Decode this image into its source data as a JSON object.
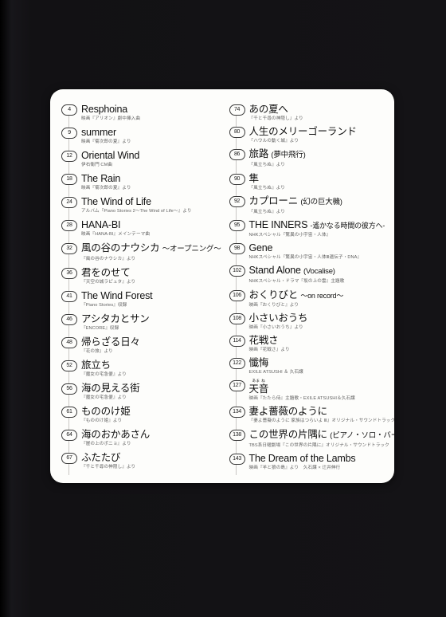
{
  "card": {
    "background": "#fdfdfb",
    "page_background": "#131215"
  },
  "tracklist": {
    "left": [
      {
        "number": "4",
        "title": "Resphoina",
        "note": "映画『アリオン』劇中挿入曲"
      },
      {
        "number": "9",
        "title": "summer",
        "note": "映画『菊次郎の夏』より"
      },
      {
        "number": "12",
        "title": "Oriental Wind",
        "note": "伊右衛門 CM曲"
      },
      {
        "number": "18",
        "title": "The Rain",
        "note": "映画『菊次郎の夏』より"
      },
      {
        "number": "24",
        "title": "The Wind of Life",
        "note": "アルバム『Piano Stories 2～The Wind of Life～』より"
      },
      {
        "number": "28",
        "title": "HANA-BI",
        "note": "映画『HANA-BI』メインテーマ曲"
      },
      {
        "number": "32",
        "title": "風の谷のナウシカ",
        "title_suffix": "～オープニング～",
        "note": "『風の谷のナウシカ』より"
      },
      {
        "number": "36",
        "title": "君をのせて",
        "note": "『天空の城ラピュタ』より"
      },
      {
        "number": "41",
        "title": "The Wind Forest",
        "note": "『Piano Stories』収録"
      },
      {
        "number": "46",
        "title": "アシタカとサン",
        "note": "『ENCORE』収録"
      },
      {
        "number": "48",
        "title": "帰らざる日々",
        "note": "『花の旅』より"
      },
      {
        "number": "52",
        "title": "旅立ち",
        "note": "『魔女の宅急便』より"
      },
      {
        "number": "56",
        "title": "海の見える街",
        "note": "『魔女の宅急便』より"
      },
      {
        "number": "61",
        "title": "もののけ姫",
        "note": "『もののけ姫』より"
      },
      {
        "number": "64",
        "title": "海のおかあさん",
        "note": "『崖の上のポニョ』より"
      },
      {
        "number": "67",
        "title": "ふたたび",
        "note": "『千と千尋の神隠し』より"
      }
    ],
    "right": [
      {
        "number": "74",
        "title": "あの夏へ",
        "note": "『千と千尋の神隠し』より"
      },
      {
        "number": "80",
        "title": "人生のメリーゴーランド",
        "note": "『ハウルの動く城』より"
      },
      {
        "number": "86",
        "title": "旅路",
        "title_suffix": "(夢中飛行)",
        "note": "『風立ちぬ』より"
      },
      {
        "number": "90",
        "title": "隼",
        "note": "『風立ちぬ』より"
      },
      {
        "number": "92",
        "title": "カプローニ",
        "title_suffix": "(幻の巨大機)",
        "note": "『風立ちぬ』より"
      },
      {
        "number": "95",
        "title": "THE INNERS",
        "title_dash": "-遙かなる時間の彼方へ-",
        "note": "NHKスペシャル『驚異の小宇宙・人体』"
      },
      {
        "number": "98",
        "title": "Gene",
        "note": "NHKスペシャル『驚異の小宇宙・人体Ⅲ遺伝子・DNA』"
      },
      {
        "number": "102",
        "title": "Stand Alone",
        "title_suffix": "(Vocalise)",
        "note": "NHKスペシャル・ドラマ『坂の上の雲』主題歌"
      },
      {
        "number": "106",
        "title": "おくりびと",
        "title_dash": "～on record～",
        "note": "映画『おくりびと』より"
      },
      {
        "number": "108",
        "title": "小さいおうち",
        "note": "映画『小さいおうち』より"
      },
      {
        "number": "114",
        "title": "花戦さ",
        "note": "映画『花戦さ』より"
      },
      {
        "number": "122",
        "title": "懺悔",
        "note": "EXILE ATSUSHI ＆ 久石譲"
      },
      {
        "number": "127",
        "title": "天音",
        "ruby": "あま ね",
        "note": "映画『たたら侍』主題歌・EXILE ATSUSHI＆久石譲"
      },
      {
        "number": "134",
        "title": "妻よ薔薇のように",
        "note": "『妻よ薔薇のように 家族はつらいよ Ⅲ』オリジナル・サウンドトラック"
      },
      {
        "number": "138",
        "title": "この世界の片隅に",
        "title_suffix": "(ピアノ・ソロ・バージョン)",
        "note": "TBS系日曜劇場『この世界の片隅に』オリジナル・サウンドトラック"
      },
      {
        "number": "143",
        "title": "The Dream of the Lambs",
        "note": "映画『羊と狼の島』より　久石譲 × 辻井伸行"
      }
    ]
  }
}
